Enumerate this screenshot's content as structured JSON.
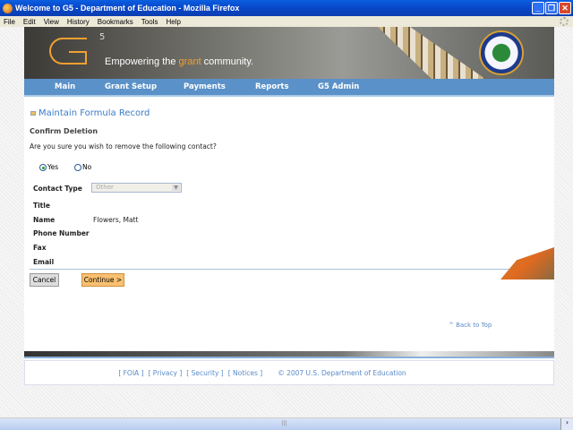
{
  "window": {
    "title": "Welcome to G5 - Department of Education - Mozilla Firefox"
  },
  "menu": [
    "File",
    "Edit",
    "View",
    "History",
    "Bookmarks",
    "Tools",
    "Help"
  ],
  "banner": {
    "logo_sup": "5",
    "tagline_pre": "Empowering the ",
    "tagline_accent": "grant",
    "tagline_post": " community."
  },
  "nav": [
    "Main",
    "Grant Setup",
    "Payments",
    "Reports",
    "G5 Admin"
  ],
  "page": {
    "title": "Maintain Formula Record",
    "section": "Confirm Deletion",
    "question": "Are you sure you wish to remove the following contact?",
    "radio_yes": "Yes",
    "radio_no": "No",
    "selected": "Yes",
    "fields": {
      "contact_type_label": "Contact Type",
      "contact_type_value": "Other",
      "title_label": "Title",
      "name_label": "Name",
      "name_value": "Flowers, Matt",
      "phone_label": "Phone Number",
      "fax_label": "Fax",
      "email_label": "Email"
    },
    "cancel": "Cancel",
    "continue": "Continue >",
    "back_to_top": "^ Back to Top"
  },
  "footer": {
    "links": [
      "[ FOIA ]",
      "[ Privacy ]",
      "[ Security ]",
      "[ Notices ]"
    ],
    "copyright": "© 2007 U.S. Department of Education"
  },
  "colors": {
    "nav": "#5a91c8",
    "accent": "#f0a030",
    "link": "#3a7cc8"
  }
}
